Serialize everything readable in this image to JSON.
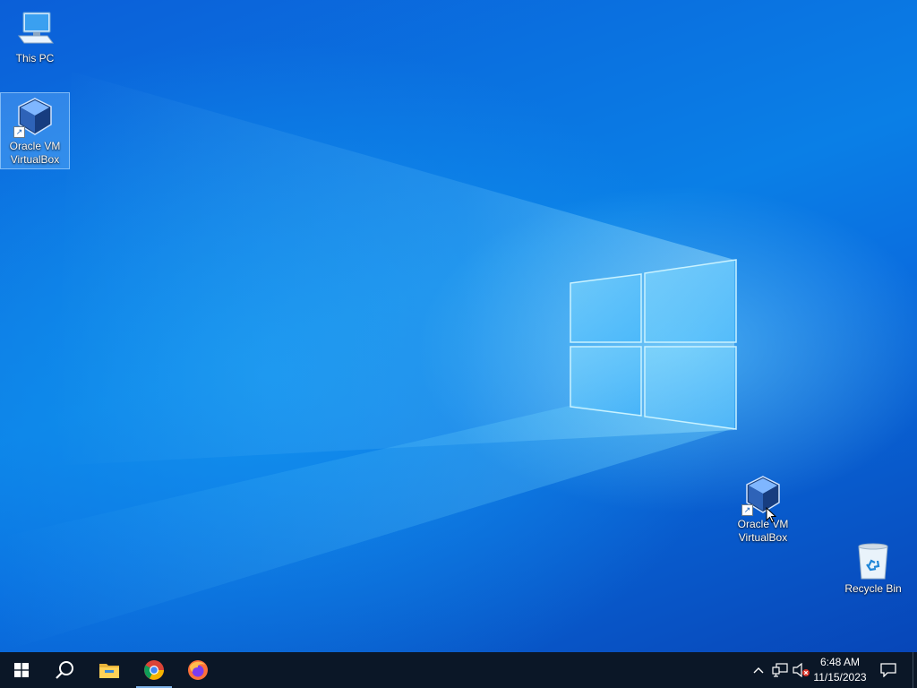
{
  "desktop": {
    "icons": [
      {
        "label": "This PC",
        "icon": "computer-icon"
      },
      {
        "label": "Oracle VM VirtualBox",
        "icon": "virtualbox-icon",
        "selected": true
      },
      {
        "label": "Oracle VM VirtualBox",
        "icon": "virtualbox-icon"
      },
      {
        "label": "Recycle Bin",
        "icon": "recycle-bin-icon"
      }
    ],
    "shortcut_glyph": "↗"
  },
  "taskbar": {
    "buttons": [
      {
        "name": "start",
        "icon": "windows-logo-icon"
      },
      {
        "name": "search",
        "icon": "search-icon"
      },
      {
        "name": "file-explorer",
        "icon": "folder-icon"
      },
      {
        "name": "chrome",
        "icon": "chrome-icon",
        "active": true
      },
      {
        "name": "firefox",
        "icon": "firefox-icon"
      }
    ],
    "tray": {
      "chevron": "^",
      "network_icon": "network-icon",
      "volume_icon": "volume-muted-icon"
    },
    "clock": {
      "time": "6:48 AM",
      "date": "11/15/2023"
    },
    "notifications_icon": "action-center-icon"
  },
  "colors": {
    "taskbar": "#0b1727",
    "desktop_accent": "#0a7fe6"
  }
}
